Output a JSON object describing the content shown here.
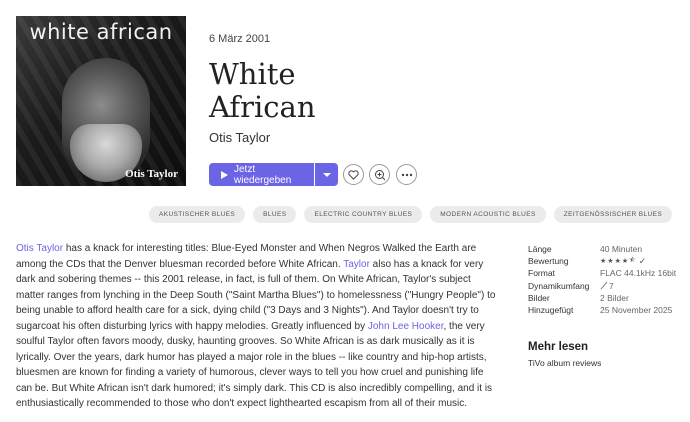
{
  "cover": {
    "title": "white african",
    "artist": "Otis Taylor"
  },
  "album": {
    "date": "6 März 2001",
    "title_line1": "White",
    "title_line2": "African",
    "artist": "Otis Taylor"
  },
  "actions": {
    "play_label": "Jetzt wiedergeben",
    "play_caret": "chevron-down-icon",
    "favorite": "heart-icon",
    "add": "add-icon",
    "more": "more-icon"
  },
  "tags": [
    "AKUSTISCHER BLUES",
    "BLUES",
    "ELECTRIC COUNTRY BLUES",
    "MODERN ACOUSTIC BLUES",
    "ZEITGENÖSSISCHER BLUES"
  ],
  "review": {
    "segments": [
      {
        "text": "Otis Taylor",
        "link": true
      },
      {
        "text": " has a knack for interesting titles: Blue-Eyed Monster and When Negros Walked the Earth are among the CDs that the Denver bluesman recorded before White African. ",
        "link": false
      },
      {
        "text": "Taylor",
        "link": true
      },
      {
        "text": " also has a knack for very dark and sobering themes -- this 2001 release, in fact, is full of them. On White African, Taylor's subject matter ranges from lynching in the Deep South (\"Saint Martha Blues\") to homelessness (\"Hungry People\") to being unable to afford health care for a sick, dying child (\"3 Days and 3 Nights\"). And Taylor doesn't try to sugarcoat his often disturbing lyrics with happy melodies. Greatly influenced by ",
        "link": false
      },
      {
        "text": "John Lee Hooker",
        "link": true
      },
      {
        "text": ", the very soulful Taylor often favors moody, dusky, haunting grooves. So White African is as dark musically as it is lyrically. Over the years, dark humor has played a major role in the blues -- like country and hip-hop artists, bluesmen are known for finding a variety of humorous, clever ways to tell you how cruel and punishing life can be. But White African isn't dark humored; it's simply dark. This CD is also incredibly compelling, and it is enthusiastically recommended to those who don't expect lighthearted escapism from all of their music.",
        "link": false
      }
    ]
  },
  "meta": [
    {
      "key": "Länge",
      "value": "40 Minuten"
    },
    {
      "key": "Bewertung",
      "value": "",
      "rating": 4.5
    },
    {
      "key": "Format",
      "value": "FLAC 44.1kHz 16bit"
    },
    {
      "key": "Dynamikumfang",
      "value": "7"
    },
    {
      "key": "Bilder",
      "value": "2 Bilder"
    },
    {
      "key": "Hinzugefügt",
      "value": "25 November 2025"
    }
  ],
  "more": {
    "heading": "Mehr lesen",
    "link": "TiVo album reviews"
  },
  "colors": {
    "accent": "#6b64e4",
    "tag_bg": "#ebebeb"
  }
}
